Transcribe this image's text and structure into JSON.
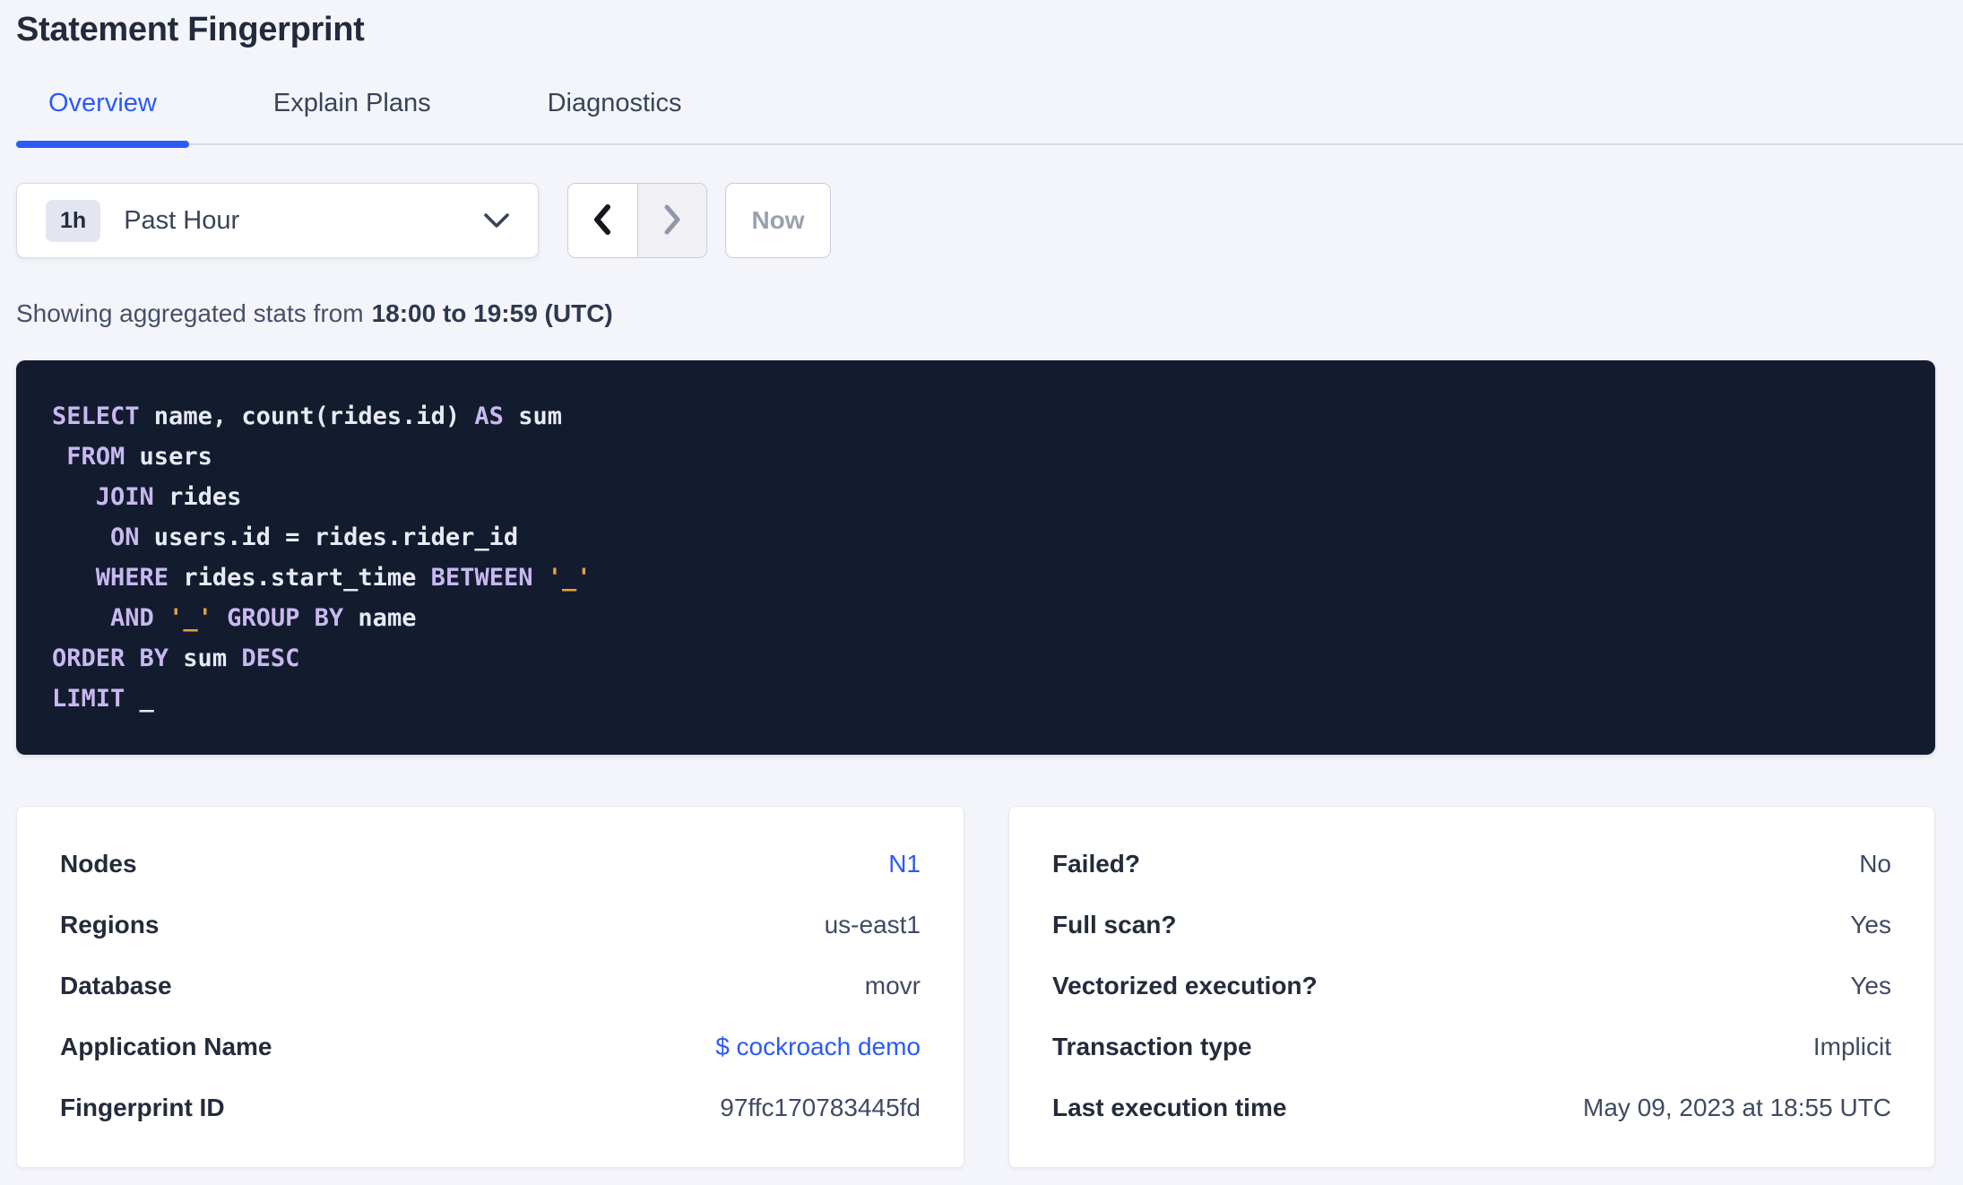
{
  "page": {
    "title": "Statement Fingerprint"
  },
  "tabs": [
    {
      "label": "Overview",
      "active": true
    },
    {
      "label": "Explain Plans",
      "active": false
    },
    {
      "label": "Diagnostics",
      "active": false
    }
  ],
  "time_controls": {
    "range_badge": "1h",
    "range_label": "Past Hour",
    "now_label": "Now",
    "prev_enabled": true,
    "next_enabled": false,
    "now_enabled": false
  },
  "caption": {
    "prefix": "Showing aggregated stats from",
    "range_bold": "18:00 to 19:59 (UTC)"
  },
  "sql": {
    "lines": [
      [
        {
          "c": "kw",
          "t": "SELECT"
        },
        {
          "c": "id",
          "t": " name, count(rides.id) "
        },
        {
          "c": "kw",
          "t": "AS"
        },
        {
          "c": "id",
          "t": " sum"
        }
      ],
      [
        {
          "c": "id",
          "t": " "
        },
        {
          "c": "kw",
          "t": "FROM"
        },
        {
          "c": "id",
          "t": " users"
        }
      ],
      [
        {
          "c": "id",
          "t": "   "
        },
        {
          "c": "kw",
          "t": "JOIN"
        },
        {
          "c": "id",
          "t": " rides"
        }
      ],
      [
        {
          "c": "id",
          "t": "    "
        },
        {
          "c": "kw",
          "t": "ON"
        },
        {
          "c": "id",
          "t": " users.id = rides.rider_id"
        }
      ],
      [
        {
          "c": "id",
          "t": "   "
        },
        {
          "c": "kw",
          "t": "WHERE"
        },
        {
          "c": "id",
          "t": " rides.start_time "
        },
        {
          "c": "kw",
          "t": "BETWEEN"
        },
        {
          "c": "id",
          "t": " "
        },
        {
          "c": "str",
          "t": "'_'"
        }
      ],
      [
        {
          "c": "id",
          "t": "    "
        },
        {
          "c": "kw",
          "t": "AND"
        },
        {
          "c": "id",
          "t": " "
        },
        {
          "c": "str",
          "t": "'_'"
        },
        {
          "c": "id",
          "t": " "
        },
        {
          "c": "kw",
          "t": "GROUP BY"
        },
        {
          "c": "id",
          "t": " name"
        }
      ],
      [
        {
          "c": "kw",
          "t": "ORDER BY"
        },
        {
          "c": "id",
          "t": " sum "
        },
        {
          "c": "kw",
          "t": "DESC"
        }
      ],
      [
        {
          "c": "kw",
          "t": "LIMIT"
        },
        {
          "c": "id",
          "t": " _"
        }
      ]
    ]
  },
  "left_card": {
    "rows": [
      {
        "label": "Nodes",
        "value": "N1",
        "link": true
      },
      {
        "label": "Regions",
        "value": "us-east1",
        "link": false
      },
      {
        "label": "Database",
        "value": "movr",
        "link": false
      },
      {
        "label": "Application Name",
        "value": "$ cockroach demo",
        "link": true
      },
      {
        "label": "Fingerprint ID",
        "value": "97ffc170783445fd",
        "link": false
      }
    ]
  },
  "right_card": {
    "rows": [
      {
        "label": "Failed?",
        "value": "No",
        "link": false
      },
      {
        "label": "Full scan?",
        "value": "Yes",
        "link": false
      },
      {
        "label": "Vectorized execution?",
        "value": "Yes",
        "link": false
      },
      {
        "label": "Transaction type",
        "value": "Implicit",
        "link": false
      },
      {
        "label": "Last execution time",
        "value": "May 09, 2023 at 18:55 UTC",
        "link": false
      }
    ]
  },
  "colors": {
    "accent_blue": "#2b5bf7",
    "page_background": "#f4f5fa",
    "sql_background": "#131b2f",
    "sql_keyword": "#c9b8f0",
    "sql_text": "#e7eaf3",
    "sql_literal": "#e8a040"
  }
}
